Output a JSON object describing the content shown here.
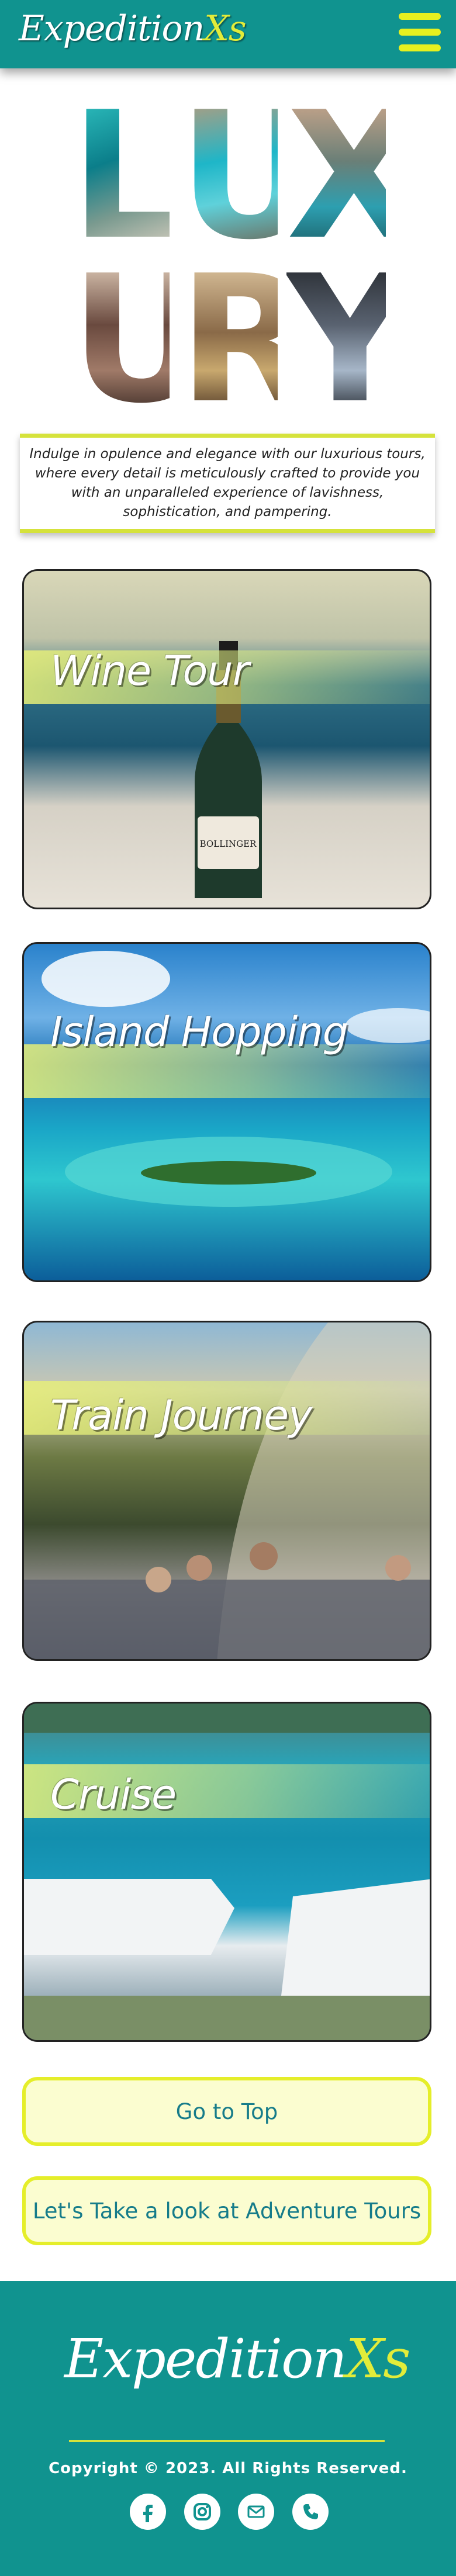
{
  "header": {
    "logo_main": "Expedition",
    "logo_accent": "Xs",
    "menu_icon": "hamburger-menu-icon"
  },
  "banner": {
    "letters": [
      "L",
      "U",
      "X",
      "U",
      "R",
      "Y"
    ]
  },
  "intro": {
    "text": "Indulge in opulence and elegance with our luxurious tours, where every detail is meticulously crafted to provide you with an unparalleled experience of lavishness, sophistication, and pampering."
  },
  "tours": [
    {
      "title": "Wine Tour"
    },
    {
      "title": "Island Hopping"
    },
    {
      "title": "Train Journey"
    },
    {
      "title": "Cruise"
    }
  ],
  "wine_bottle_label": "BOLLINGER",
  "buttons": {
    "top": "Go to Top",
    "adventure": "Let's Take a look at Adventure Tours"
  },
  "footer": {
    "logo_main": "Expedition",
    "logo_accent": "Xs",
    "copyright": "Copyright © 2023. All Rights Reserved.",
    "socials": [
      "facebook-icon",
      "instagram-icon",
      "email-icon",
      "phone-icon"
    ]
  },
  "colors": {
    "brand_teal": "#10938f",
    "accent_yellow": "#e5ee2a",
    "button_bg": "#fbfdd0",
    "button_text": "#167c8a"
  }
}
